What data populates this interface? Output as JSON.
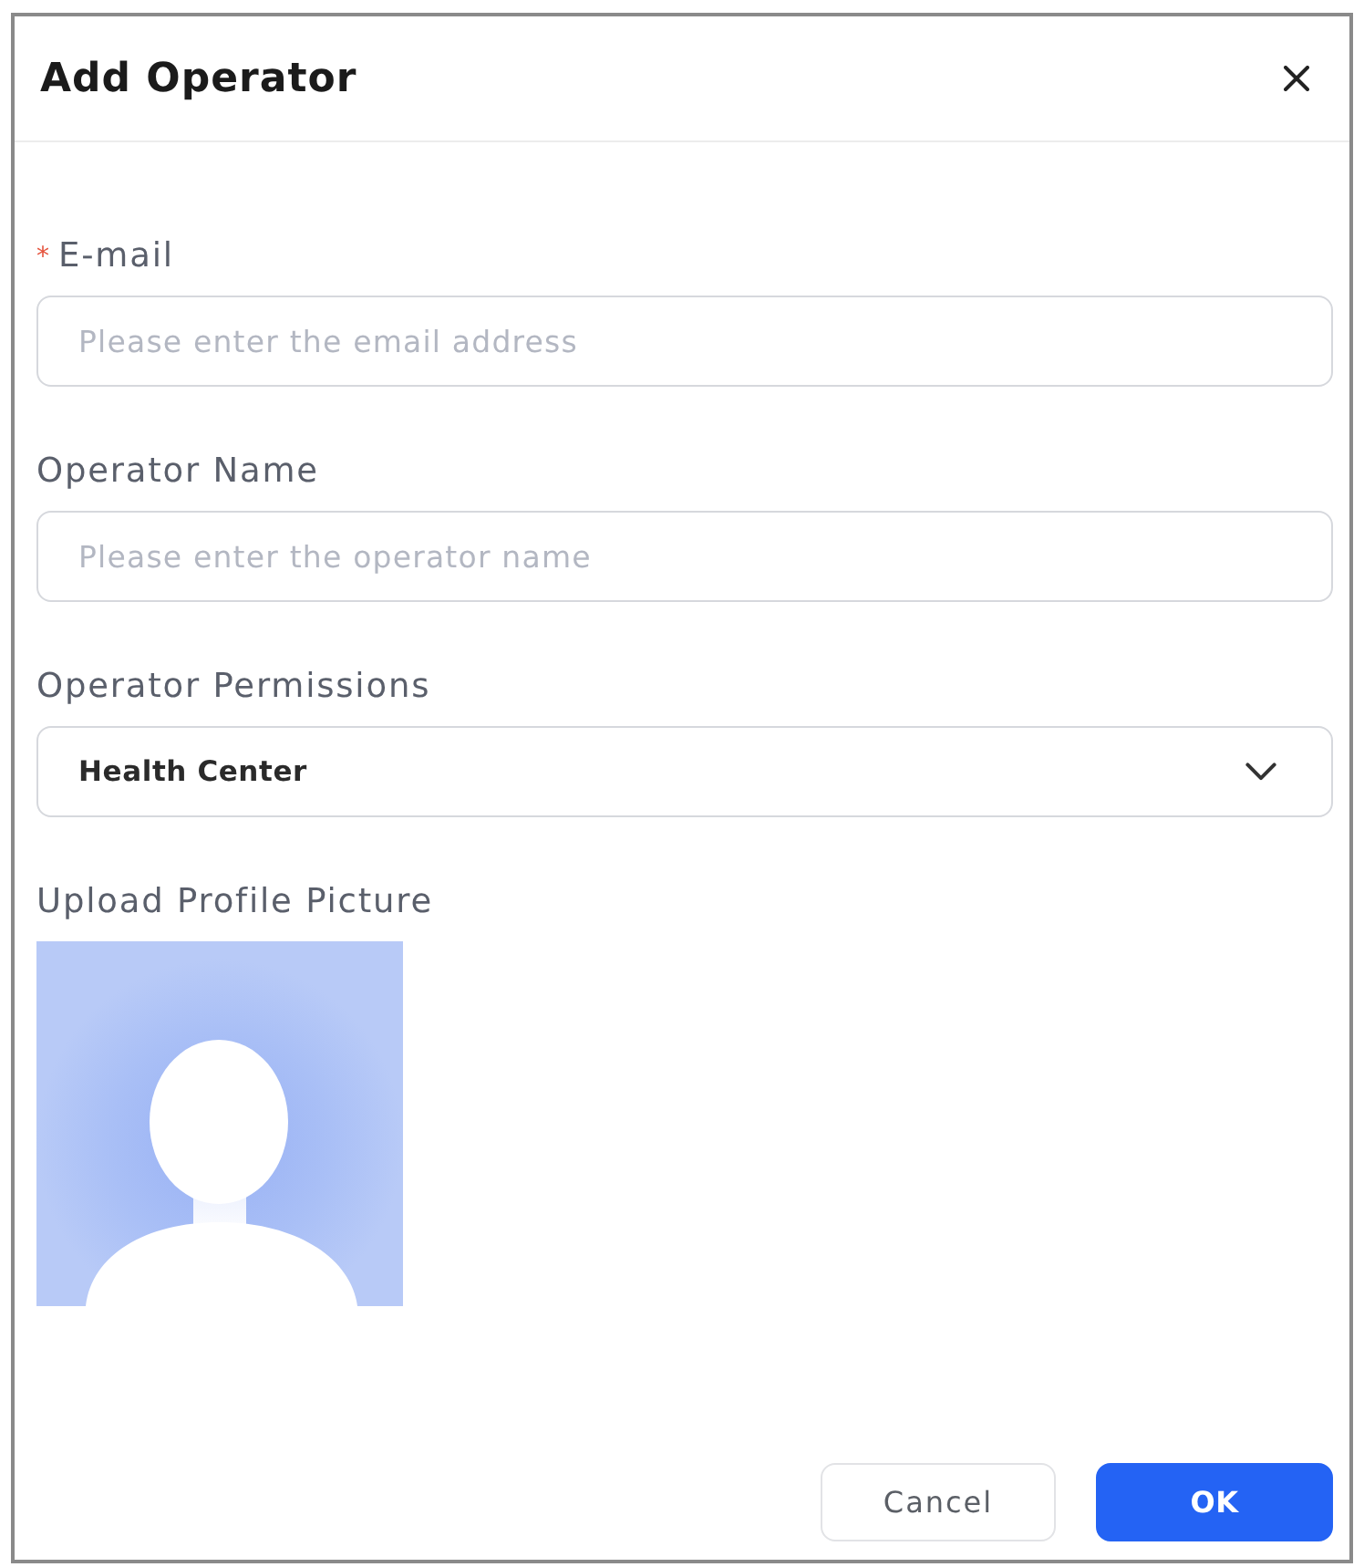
{
  "dialog": {
    "title": "Add Operator"
  },
  "fields": [
    {
      "kind": "input",
      "label": "E-mail",
      "required_mark": "*",
      "placeholder": "Please enter the email address"
    },
    {
      "kind": "input",
      "label": "Operator Name",
      "placeholder": "Please enter the operator name"
    },
    {
      "kind": "select",
      "label": "Operator Permissions",
      "value": "Health Center"
    },
    {
      "kind": "upload",
      "label": "Upload Profile Picture"
    }
  ],
  "buttons": [
    {
      "kind": "secondary",
      "label": "Cancel"
    },
    {
      "kind": "primary",
      "label": "OK"
    }
  ]
}
